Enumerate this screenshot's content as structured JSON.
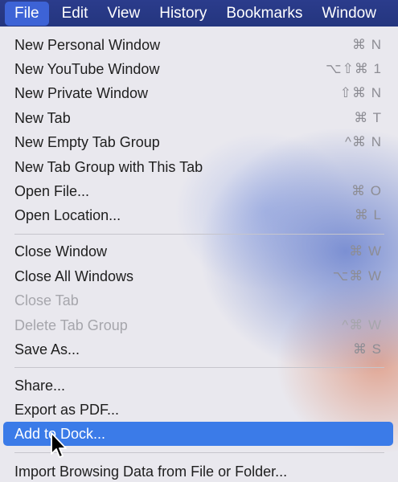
{
  "menubar": {
    "items": [
      {
        "label": "File",
        "active": true
      },
      {
        "label": "Edit"
      },
      {
        "label": "View"
      },
      {
        "label": "History"
      },
      {
        "label": "Bookmarks"
      },
      {
        "label": "Window"
      }
    ]
  },
  "menu": {
    "groups": [
      [
        {
          "label": "New Personal Window",
          "shortcut": "⌘ N"
        },
        {
          "label": "New YouTube Window",
          "shortcut": "⌥⇧⌘ 1"
        },
        {
          "label": "New Private Window",
          "shortcut": "⇧⌘ N"
        },
        {
          "label": "New Tab",
          "shortcut": "⌘ T"
        },
        {
          "label": "New Empty Tab Group",
          "shortcut": "^⌘ N"
        },
        {
          "label": "New Tab Group with This Tab",
          "shortcut": ""
        },
        {
          "label": "Open File...",
          "shortcut": "⌘ O"
        },
        {
          "label": "Open Location...",
          "shortcut": "⌘ L"
        }
      ],
      [
        {
          "label": "Close Window",
          "shortcut": "⌘ W"
        },
        {
          "label": "Close All Windows",
          "shortcut": "⌥⌘ W"
        },
        {
          "label": "Close Tab",
          "shortcut": "",
          "disabled": true
        },
        {
          "label": "Delete Tab Group",
          "shortcut": "^⌘ W",
          "disabled": true
        },
        {
          "label": "Save As...",
          "shortcut": "⌘ S"
        }
      ],
      [
        {
          "label": "Share...",
          "shortcut": ""
        },
        {
          "label": "Export as PDF...",
          "shortcut": ""
        },
        {
          "label": "Add to Dock...",
          "shortcut": "",
          "highlighted": true
        }
      ],
      [
        {
          "label": "Import Browsing Data from File or Folder...",
          "shortcut": ""
        }
      ]
    ]
  },
  "colors": {
    "menubar_bg": "#24357e",
    "highlight": "#3b7be8",
    "disabled_text": "#a6a6ac"
  },
  "icons": {
    "cursor": "arrow-cursor-icon"
  }
}
